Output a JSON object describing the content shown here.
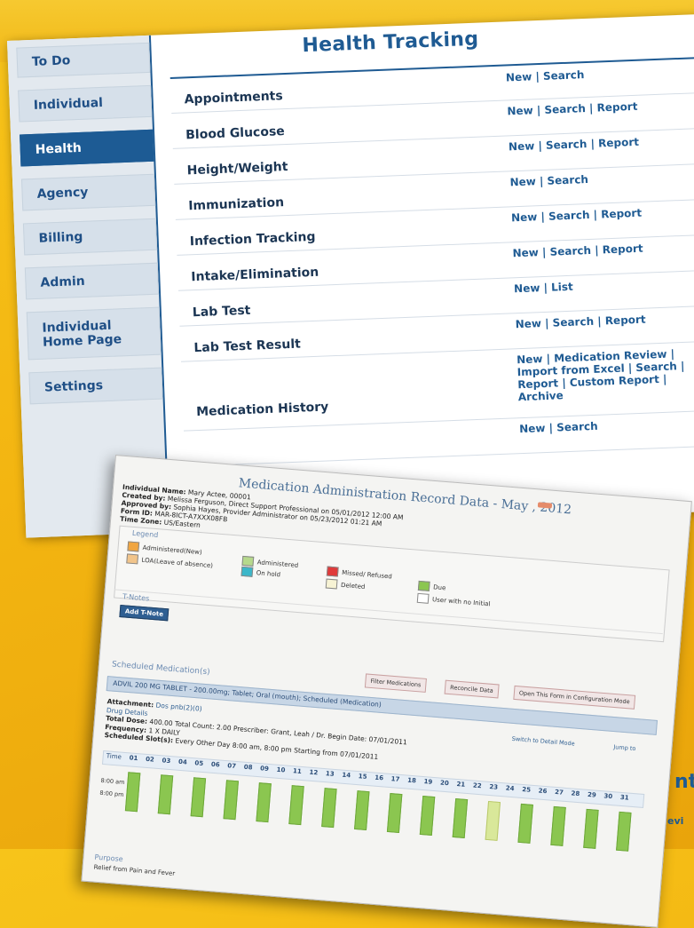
{
  "health_page": {
    "title": "Health Tracking",
    "nav": [
      {
        "label": "To Do",
        "active": false
      },
      {
        "label": "Individual",
        "active": false
      },
      {
        "label": "Health",
        "active": true
      },
      {
        "label": "Agency",
        "active": false
      },
      {
        "label": "Billing",
        "active": false
      },
      {
        "label": "Admin",
        "active": false
      },
      {
        "label": "Individual Home Page",
        "active": false
      },
      {
        "label": "Settings",
        "active": false
      }
    ],
    "rows": [
      {
        "label": "Appointments",
        "actions": "New | Search"
      },
      {
        "label": "Blood Glucose",
        "actions": "New | Search | Report"
      },
      {
        "label": "Height/Weight",
        "actions": "New | Search | Report"
      },
      {
        "label": "Immunization",
        "actions": "New | Search"
      },
      {
        "label": "Infection Tracking",
        "actions": "New | Search | Report"
      },
      {
        "label": "Intake/Elimination",
        "actions": "New | Search | Report"
      },
      {
        "label": "Lab Test",
        "actions": "New | List"
      },
      {
        "label": "Lab Test Result",
        "actions": "New | Search | Report"
      },
      {
        "label": "Medication History",
        "actions": "New | Medication Review | Import from Excel | Search | Report | Custom Report | Archive"
      },
      {
        "label": "",
        "actions": "New | Search"
      }
    ]
  },
  "mar": {
    "title": "Medication Administration Record Data - May , 2012",
    "info": [
      {
        "k": "Individual Name:",
        "v": "Mary Actee, 00001"
      },
      {
        "k": "Created by:",
        "v": "Melissa Ferguson, Direct Support Professional on 05/01/2012 12:00 AM"
      },
      {
        "k": "Approved by:",
        "v": "Sophia Hayes, Provider Administrator on 05/23/2012 01:21 AM"
      },
      {
        "k": "Form ID:",
        "v": "MAR-8ICT-A7XXX08FB"
      },
      {
        "k": "Time Zone:",
        "v": "US/Eastern"
      }
    ],
    "legend_title": "Legend",
    "legend": [
      {
        "label": "Administered(New)",
        "color": "#f0a540"
      },
      {
        "label": "LOA(Leave of absence)",
        "color": "#f1c48a"
      },
      {
        "label": "Administered",
        "color": "#b6d98c"
      },
      {
        "label": "On hold",
        "color": "#3bb7c9"
      },
      {
        "label": "Missed/ Refused",
        "color": "#e03a3a"
      },
      {
        "label": "Deleted",
        "color": "#f7f3d4"
      },
      {
        "label": "Due",
        "color": "#8bc650"
      },
      {
        "label": "User with no Initial",
        "color": "#ffffff"
      }
    ],
    "tnotes_title": "T-Notes",
    "add_tnote": "Add T-Note",
    "scheduled_title": "Scheduled Medication(s)",
    "buttons": [
      "Filter Medications",
      "Reconcile Data",
      "Open This Form in Configuration Mode"
    ],
    "med_bar": "ADVIL 200 MG TABLET - 200.00mg; Tablet; Oral (mouth); Scheduled (Medication)",
    "details": [
      {
        "k": "Attachment:",
        "v": "Dos pnb(2)(0)"
      },
      {
        "k": "",
        "v": "Drug Details"
      },
      {
        "k": "Total Dose:",
        "v": "400.00   Total Count: 2.00   Prescriber: Grant, Leah / Dr.   Begin Date: 07/01/2011"
      },
      {
        "k": "Frequency:",
        "v": "1 X DAILY"
      },
      {
        "k": "Scheduled Slot(s):",
        "v": "Every Other Day 8:00 am, 8:00 pm Starting from 07/01/2011"
      }
    ],
    "links": [
      "Switch to Detail Mode",
      "Jump to"
    ],
    "grid_label": "Time",
    "days": [
      "01",
      "02",
      "03",
      "04",
      "05",
      "06",
      "07",
      "08",
      "09",
      "10",
      "11",
      "12",
      "13",
      "14",
      "15",
      "16",
      "17",
      "18",
      "19",
      "20",
      "21",
      "22",
      "23",
      "24",
      "25",
      "26",
      "27",
      "28",
      "29",
      "30",
      "31"
    ],
    "times": [
      "8:00 am",
      "8:00 pm"
    ],
    "today_day": "23",
    "purpose_title": "Purpose",
    "purpose_text": "Relief from Pain and Fever"
  },
  "edge_fragments": {
    "right_upper": "nt",
    "right_lower": "evi"
  }
}
